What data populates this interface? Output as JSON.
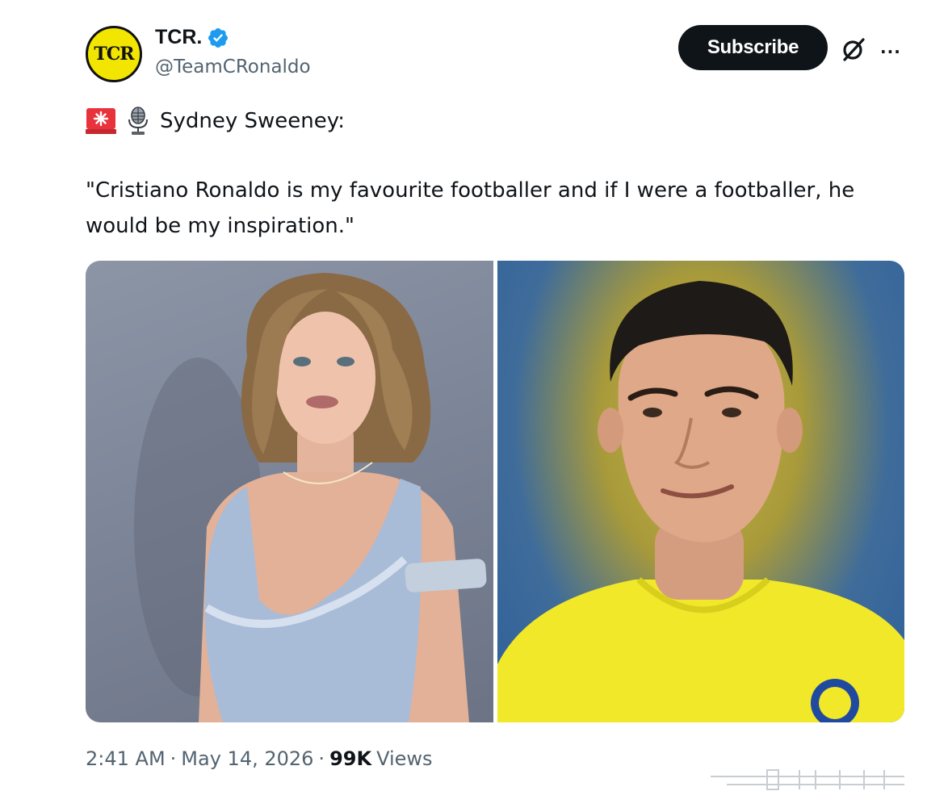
{
  "author": {
    "avatar_text": "TCR",
    "display_name": "TCR.",
    "handle": "@TeamCRonaldo",
    "verified": true
  },
  "actions": {
    "subscribe_label": "Subscribe",
    "grok_icon": "grok-icon",
    "more_icon": "more-icon"
  },
  "tweet": {
    "alert_icons": [
      "siren-icon",
      "microphone-icon"
    ],
    "alert_text": "Sydney Sweeney:",
    "quote": "\"Cristiano Ronaldo is my favourite footballer and if I were a footballer, he would be my inspiration.\""
  },
  "media": [
    {
      "subject": "woman-portrait"
    },
    {
      "subject": "footballer-portrait"
    }
  ],
  "meta": {
    "time": "2:41 AM",
    "sep1": "·",
    "date": "May 14, 2026",
    "sep2": "·",
    "views_count": "99K",
    "views_label": "Views"
  },
  "colors": {
    "text_primary": "#0f1419",
    "text_secondary": "#536471",
    "verified_blue": "#1d9bf0",
    "avatar_yellow": "#f2e600",
    "button_dark": "#0f1419"
  }
}
